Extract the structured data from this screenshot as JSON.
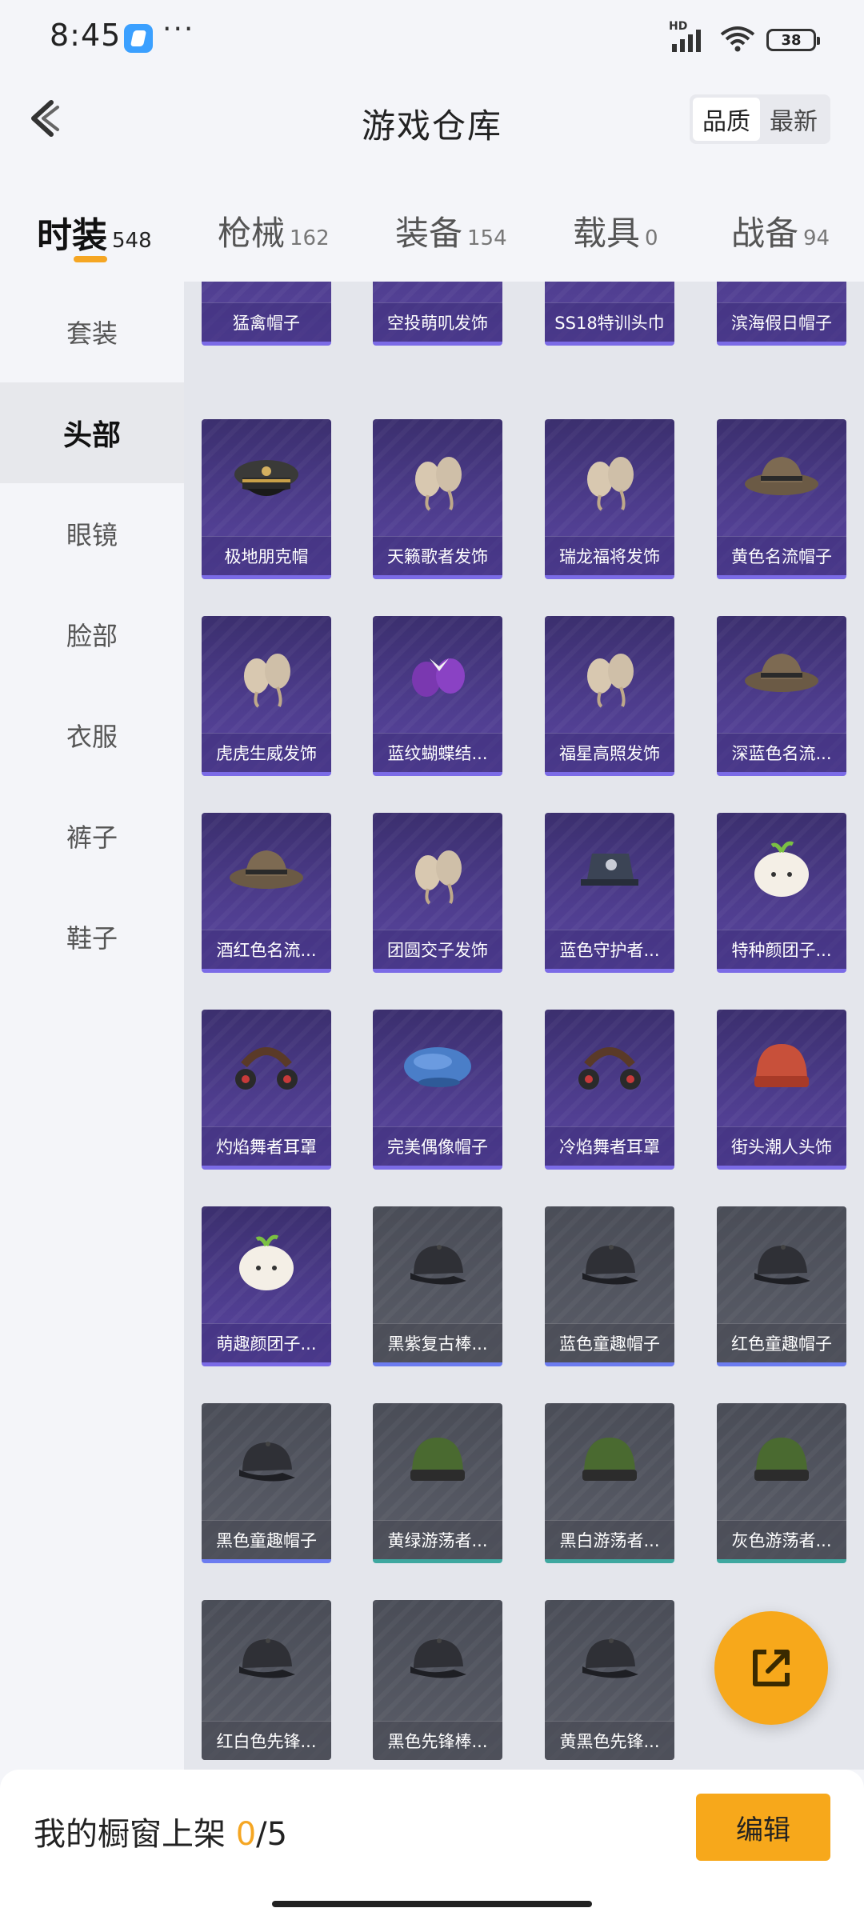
{
  "status_bar": {
    "time": "8:45",
    "more": "···",
    "network_label": "HD",
    "battery": "38",
    "icons": [
      "app-icon",
      "signal-icon",
      "wifi-icon",
      "battery-icon"
    ]
  },
  "header": {
    "title": "游戏仓库",
    "back_icon": "back-arrow-icon",
    "sort_options": [
      "品质",
      "最新"
    ],
    "sort_selected": "品质"
  },
  "category_tabs": [
    {
      "label": "时装",
      "count": "548",
      "active": true
    },
    {
      "label": "枪械",
      "count": "162",
      "active": false
    },
    {
      "label": "装备",
      "count": "154",
      "active": false
    },
    {
      "label": "载具",
      "count": "0",
      "active": false
    },
    {
      "label": "战备",
      "count": "94",
      "active": false
    }
  ],
  "sidebar": {
    "items": [
      {
        "label": "套装",
        "active": false
      },
      {
        "label": "头部",
        "active": true
      },
      {
        "label": "眼镜",
        "active": false
      },
      {
        "label": "脸部",
        "active": false
      },
      {
        "label": "衣服",
        "active": false
      },
      {
        "label": "裤子",
        "active": false
      },
      {
        "label": "鞋子",
        "active": false
      }
    ]
  },
  "items": [
    {
      "name": "猛禽帽子",
      "rarity": "purple",
      "icon": "hat-icon"
    },
    {
      "name": "空投萌叽发饰",
      "rarity": "purple",
      "icon": "hair-accessory-icon"
    },
    {
      "name": "SS18特训头巾",
      "rarity": "purple",
      "icon": "headband-icon"
    },
    {
      "name": "滨海假日帽子",
      "rarity": "purple",
      "icon": "hat-icon"
    },
    {
      "name": "极地朋克帽",
      "rarity": "purple",
      "icon": "officer-cap-icon"
    },
    {
      "name": "天籁歌者发饰",
      "rarity": "purple",
      "icon": "hair-accessory-icon"
    },
    {
      "name": "瑞龙福将发饰",
      "rarity": "purple",
      "icon": "hair-accessory-icon"
    },
    {
      "name": "黄色名流帽子",
      "rarity": "purple",
      "icon": "fedora-icon"
    },
    {
      "name": "虎虎生威发饰",
      "rarity": "purple",
      "icon": "hair-accessory-icon"
    },
    {
      "name": "蓝纹蝴蝶结...",
      "rarity": "purple",
      "icon": "bow-icon"
    },
    {
      "name": "福星高照发饰",
      "rarity": "purple",
      "icon": "hair-accessory-icon"
    },
    {
      "name": "深蓝色名流...",
      "rarity": "purple",
      "icon": "fedora-icon"
    },
    {
      "name": "酒红色名流...",
      "rarity": "purple",
      "icon": "fedora-icon"
    },
    {
      "name": "团圆交子发饰",
      "rarity": "purple",
      "icon": "hair-accessory-icon"
    },
    {
      "name": "蓝色守护者...",
      "rarity": "purple",
      "icon": "cap-icon"
    },
    {
      "name": "特种颜团子...",
      "rarity": "purple",
      "icon": "dumpling-hat-icon"
    },
    {
      "name": "灼焰舞者耳罩",
      "rarity": "purple",
      "icon": "earmuff-icon"
    },
    {
      "name": "完美偶像帽子",
      "rarity": "purple",
      "icon": "beret-icon"
    },
    {
      "name": "冷焰舞者耳罩",
      "rarity": "purple",
      "icon": "earmuff-icon"
    },
    {
      "name": "街头潮人头饰",
      "rarity": "purple",
      "icon": "beanie-icon"
    },
    {
      "name": "萌趣颜团子...",
      "rarity": "purple",
      "icon": "dumpling-hat-icon"
    },
    {
      "name": "黑紫复古棒...",
      "rarity": "gray-blue",
      "icon": "baseball-cap-icon"
    },
    {
      "name": "蓝色童趣帽子",
      "rarity": "gray-blue",
      "icon": "baseball-cap-icon"
    },
    {
      "name": "红色童趣帽子",
      "rarity": "gray-blue",
      "icon": "baseball-cap-icon"
    },
    {
      "name": "黑色童趣帽子",
      "rarity": "gray-blue",
      "icon": "baseball-cap-icon"
    },
    {
      "name": "黄绿游荡者...",
      "rarity": "gray-teal",
      "icon": "beanie-icon"
    },
    {
      "name": "黑白游荡者...",
      "rarity": "gray-teal",
      "icon": "beanie-icon"
    },
    {
      "name": "灰色游荡者...",
      "rarity": "gray-teal",
      "icon": "beanie-icon"
    },
    {
      "name": "红白色先锋...",
      "rarity": "gray",
      "icon": "baseball-cap-icon"
    },
    {
      "name": "黑色先锋棒...",
      "rarity": "gray",
      "icon": "baseball-cap-icon"
    },
    {
      "name": "黄黑色先锋...",
      "rarity": "gray",
      "icon": "baseball-cap-icon"
    }
  ],
  "fab": {
    "icon": "share-icon"
  },
  "bottom_bar": {
    "label": "我的橱窗上架",
    "current": "0",
    "separator_total": "/5",
    "edit_label": "编辑"
  },
  "colors": {
    "accent": "#f7a81b",
    "purple_card": "#4d3c8c",
    "purple_border": "#7b6be6",
    "gray_card": "#555862",
    "blue_border": "#6c7cf0",
    "teal_border": "#3fa8a0"
  }
}
